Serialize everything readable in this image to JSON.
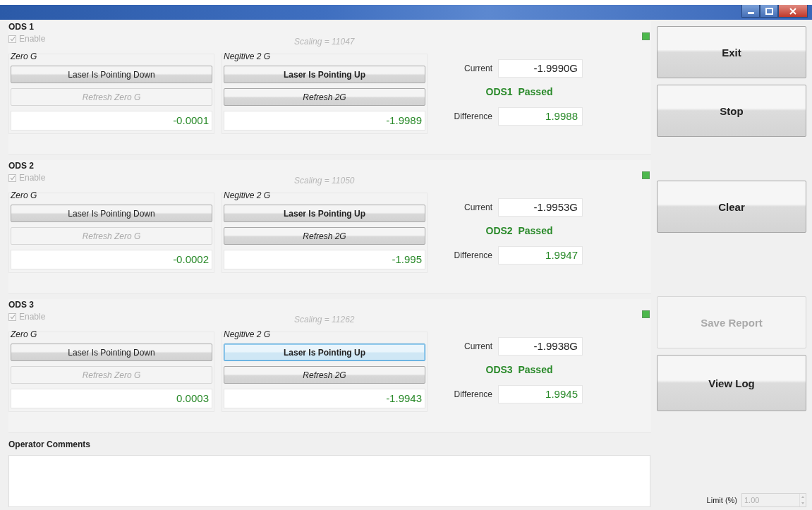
{
  "panels": [
    {
      "title": "ODS 1",
      "enable": {
        "label": "Enable",
        "checked": true,
        "disabled": true
      },
      "scaling": "Scaling = 11047",
      "zero_group": {
        "label": "Zero G",
        "button": "Laser Is Pointing Down",
        "refresh": {
          "label": "Refresh Zero G",
          "disabled": true
        },
        "value": "-0.0001"
      },
      "neg_group": {
        "label": "Negitive 2 G",
        "button": {
          "label": "Laser Is Pointing Up",
          "focused": false
        },
        "refresh": {
          "label": "Refresh 2G",
          "disabled": false
        },
        "value": "-1.9989"
      },
      "current_label": "Current",
      "current": "-1.9990G",
      "result": "ODS1  Passed",
      "passed": true,
      "difference_label": "Difference",
      "difference": "1.9988"
    },
    {
      "title": "ODS 2",
      "enable": {
        "label": "Enable",
        "checked": true,
        "disabled": true
      },
      "scaling": "Scaling = 11050",
      "zero_group": {
        "label": "Zero G",
        "button": "Laser Is Pointing Down",
        "refresh": {
          "label": "Refresh Zero G",
          "disabled": true
        },
        "value": "-0.0002"
      },
      "neg_group": {
        "label": "Negitive 2 G",
        "button": {
          "label": "Laser Is Pointing Up",
          "focused": false
        },
        "refresh": {
          "label": "Refresh 2G",
          "disabled": false
        },
        "value": "-1.995"
      },
      "current_label": "Current",
      "current": "-1.9953G",
      "result": "ODS2  Passed",
      "passed": true,
      "difference_label": "Difference",
      "difference": "1.9947"
    },
    {
      "title": "ODS 3",
      "enable": {
        "label": "Enable",
        "checked": true,
        "disabled": true
      },
      "scaling": "Scaling = 11262",
      "zero_group": {
        "label": "Zero G",
        "button": "Laser Is Pointing Down",
        "refresh": {
          "label": "Refresh Zero G",
          "disabled": true
        },
        "value": "0.0003"
      },
      "neg_group": {
        "label": "Negitive 2 G",
        "button": {
          "label": "Laser Is Pointing Up",
          "focused": true
        },
        "refresh": {
          "label": "Refresh 2G",
          "disabled": false
        },
        "value": "-1.9943"
      },
      "current_label": "Current",
      "current": "-1.9938G",
      "result": "ODS3  Passed",
      "passed": true,
      "difference_label": "Difference",
      "difference": "1.9945"
    }
  ],
  "comments": {
    "label": "Operator Comments"
  },
  "buttons": [
    {
      "label": "Exit",
      "kind": "exit",
      "disabled": false
    },
    {
      "label": "Stop",
      "kind": "stop",
      "disabled": false
    },
    {
      "label": "Clear",
      "kind": "clear",
      "disabled": false
    },
    {
      "label": "Save Report",
      "kind": "save",
      "disabled": true
    },
    {
      "label": "View Log",
      "kind": "log",
      "disabled": false
    }
  ],
  "limit": {
    "label": "Limit (%)",
    "value": "1.00"
  }
}
